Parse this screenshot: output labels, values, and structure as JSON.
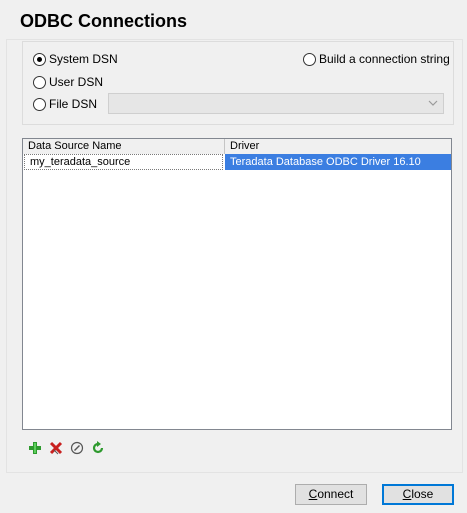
{
  "dialog": {
    "title": "ODBC Connections"
  },
  "options": {
    "system_dsn": "System DSN",
    "user_dsn": "User DSN",
    "file_dsn": "File DSN",
    "build_string": "Build a connection string",
    "selected": "system_dsn"
  },
  "grid": {
    "columns": [
      "Data Source Name",
      "Driver"
    ],
    "rows": [
      {
        "name": "my_teradata_source",
        "driver": "Teradata Database ODBC Driver 16.10"
      }
    ]
  },
  "toolbar": {
    "icons": [
      "add-icon",
      "delete-icon",
      "edit-icon",
      "refresh-icon"
    ]
  },
  "buttons": {
    "connect_first": "C",
    "connect_rest": "onnect",
    "close_first": "C",
    "close_rest": "lose"
  },
  "colors": {
    "selection": "#3b7ee1",
    "default_button_border": "#0078d7"
  }
}
